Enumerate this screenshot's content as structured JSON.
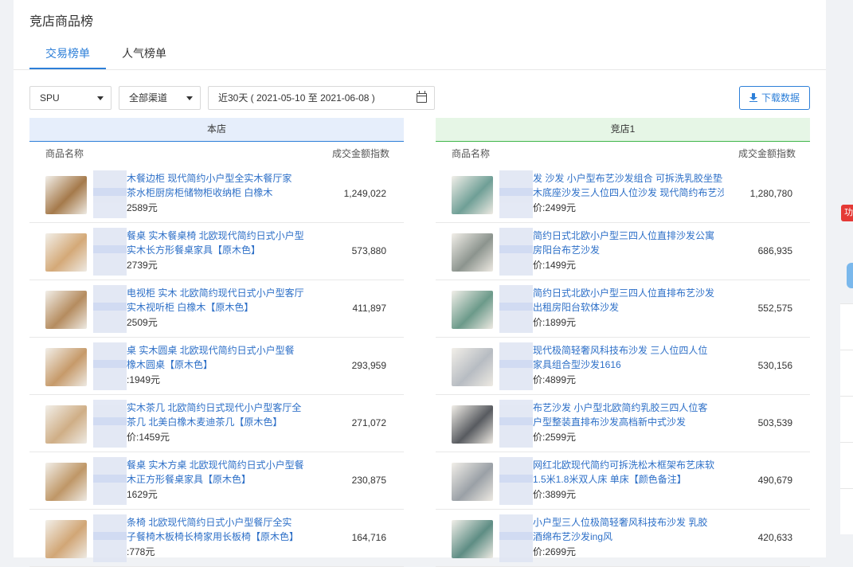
{
  "page_title": "竞店商品榜",
  "tabs": [
    {
      "label": "交易榜单"
    },
    {
      "label": "人气榜单"
    }
  ],
  "filters": {
    "type_select": "SPU",
    "channel_select": "全部渠道",
    "date_range": "近30天 ( 2021-05-10 至 2021-06-08 )",
    "download_label": "下载数据"
  },
  "left_table": {
    "title": "本店",
    "col_name": "商品名称",
    "col_value": "成交金额指数",
    "rows": [
      {
        "line1": "木餐边柜 现代简约小户型全实木餐厅家",
        "line2": "茶水柜厨房柜储物柜收纳柜 白橡木",
        "price": "2589元",
        "value": "1,249,022",
        "color": "#a57a4b"
      },
      {
        "line1": "餐桌 实木餐桌椅 北欧现代简约日式小户型",
        "line2": "实木长方形餐桌家具【原木色】",
        "price": "2739元",
        "value": "573,880",
        "color": "#d4a978"
      },
      {
        "line1": "电视柜 实木 北欧简约现代日式小户型客厅",
        "line2": "实木视听柜 白橡木【原木色】",
        "price": "2509元",
        "value": "411,897",
        "color": "#b58c5f"
      },
      {
        "line1": "桌 实木圆桌 北欧现代简约日式小户型餐",
        "line2": "橡木圆桌【原木色】",
        "price": ":1949元",
        "value": "293,959",
        "color": "#c69a6a"
      },
      {
        "line1": "实木茶几 北欧简约日式现代小户型客厅全",
        "line2": "茶几 北美白橡木麦迪茶几【原木色】",
        "price": "价:1459元",
        "value": "271,072",
        "color": "#cfae86"
      },
      {
        "line1": "餐桌 实木方桌 北欧现代简约日式小户型餐",
        "line2": "木正方形餐桌家具【原木色】",
        "price": "1629元",
        "value": "230,875",
        "color": "#bf9767"
      },
      {
        "line1": "条椅 北欧现代简约日式小户型餐厅全实",
        "line2": "子餐椅木板椅长椅家用长板椅【原木色】",
        "price": ":778元",
        "value": "164,716",
        "color": "#d1a676"
      }
    ]
  },
  "right_table": {
    "title": "竞店1",
    "col_name": "商品名称",
    "col_value": "成交金额指数",
    "rows": [
      {
        "line1": "发 沙发 小户型布艺沙发组合 可拆洗乳胶坐垫",
        "line2": "木底座沙发三人位四人位沙发 现代简约布艺沙",
        "price": "价:2499元",
        "value": "1,280,780",
        "color": "#6f9f96"
      },
      {
        "line1": "简约日式北欧小户型三四人位直排沙发公寓",
        "line2": "房阳台布艺沙发",
        "price": "价:1499元",
        "value": "686,935",
        "color": "#8c948e"
      },
      {
        "line1": "简约日式北欧小户型三四人位直排布艺沙发",
        "line2": "出租房阳台软体沙发",
        "price": "价:1899元",
        "value": "552,575",
        "color": "#6c9a8a"
      },
      {
        "line1": "现代极简轻奢风科技布沙发 三人位四人位",
        "line2": "家具组合型沙发1616",
        "price": "价:4899元",
        "value": "530,156",
        "color": "#b7bcc2"
      },
      {
        "line1": "布艺沙发 小户型北欧简约乳胶三四人位客",
        "line2": "户型整装直排布沙发高档新中式沙发",
        "price": "价:2599元",
        "value": "503,539",
        "color": "#585b60"
      },
      {
        "line1": "网红北欧现代简约可拆洗松木框架布艺床软",
        "line2": "1.5米1.8米双人床 单床【颜色备注】",
        "price": "价:3899元",
        "value": "490,679",
        "color": "#9aa0a6"
      },
      {
        "line1": "小户型三人位极简轻奢风科技布沙发 乳胶",
        "line2": "酒绵布艺沙发ing风",
        "price": "价:2699元",
        "value": "420,633",
        "color": "#5e8d84"
      }
    ]
  },
  "edge_badge": "功"
}
